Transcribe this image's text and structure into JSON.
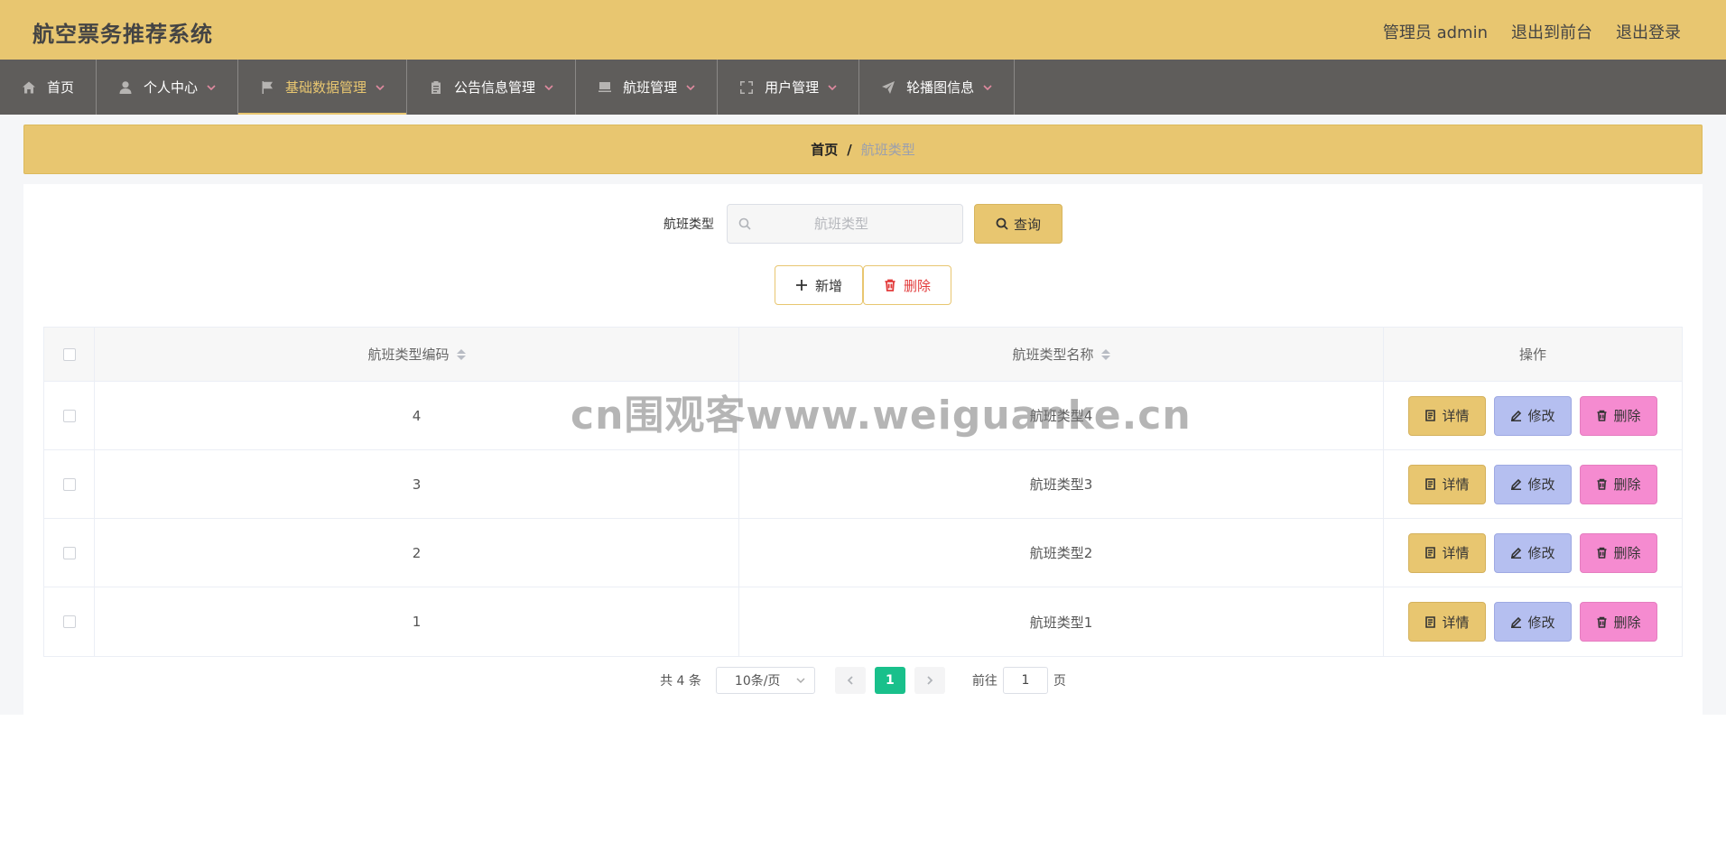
{
  "header": {
    "title": "航空票务推荐系统",
    "admin_label": "管理员 admin",
    "back_label": "退出到前台",
    "logout_label": "退出登录"
  },
  "nav": {
    "items": [
      {
        "label": "首页",
        "icon": "home-icon",
        "dropdown": false
      },
      {
        "label": "个人中心",
        "icon": "user-icon",
        "dropdown": true
      },
      {
        "label": "基础数据管理",
        "icon": "flag-icon",
        "dropdown": true,
        "active": true
      },
      {
        "label": "公告信息管理",
        "icon": "clipboard-icon",
        "dropdown": true
      },
      {
        "label": "航班管理",
        "icon": "flight-icon",
        "dropdown": true
      },
      {
        "label": "用户管理",
        "icon": "fullscreen-icon",
        "dropdown": true
      },
      {
        "label": "轮播图信息",
        "icon": "send-icon",
        "dropdown": true
      }
    ]
  },
  "breadcrumb": {
    "home": "首页",
    "separator": "/",
    "current": "航班类型"
  },
  "search": {
    "label": "航班类型",
    "placeholder": "航班类型",
    "query_label": "查询"
  },
  "actions": {
    "add_label": "新增",
    "delete_label": "删除"
  },
  "table": {
    "headers": {
      "code": "航班类型编码",
      "name": "航班类型名称",
      "ops": "操作"
    },
    "rows": [
      {
        "code": "4",
        "name": "航班类型4"
      },
      {
        "code": "3",
        "name": "航班类型3"
      },
      {
        "code": "2",
        "name": "航班类型2"
      },
      {
        "code": "1",
        "name": "航班类型1"
      }
    ],
    "op_labels": {
      "detail": "详情",
      "edit": "修改",
      "delete": "删除"
    }
  },
  "pagination": {
    "total": "共 4 条",
    "page_size": "10条/页",
    "current_page": "1",
    "goto_label": "前往",
    "goto_value": "1",
    "page_suffix": "页"
  },
  "watermark": "cn围观客www.weiguanke.cn",
  "colors": {
    "header_bg": "#e8c670",
    "nav_bg": "#5f5d5b",
    "accent": "#e8c670",
    "edit_btn": "#b5bff0",
    "delete_btn": "#f58bd0",
    "page_active": "#19c08b"
  }
}
